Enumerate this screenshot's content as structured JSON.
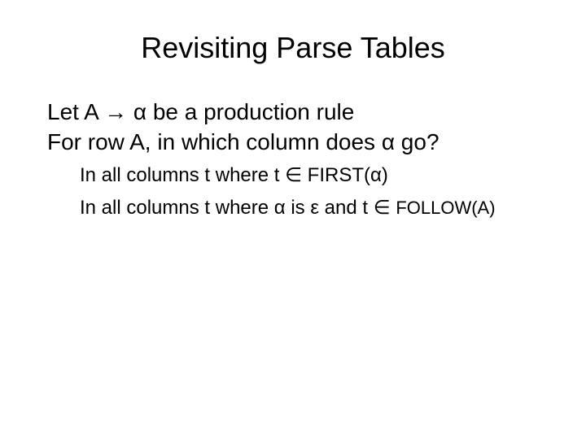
{
  "title": "Revisiting Parse Tables",
  "line1": "Let A → α be a production rule",
  "line2": "For row A, in which column does α go?",
  "sub1": "In all columns t where t ∈ FIRST(α)",
  "sub2_prefix": "In all columns t where α is ε and t ∈ ",
  "sub2_follow": "FOLLOW(A)"
}
